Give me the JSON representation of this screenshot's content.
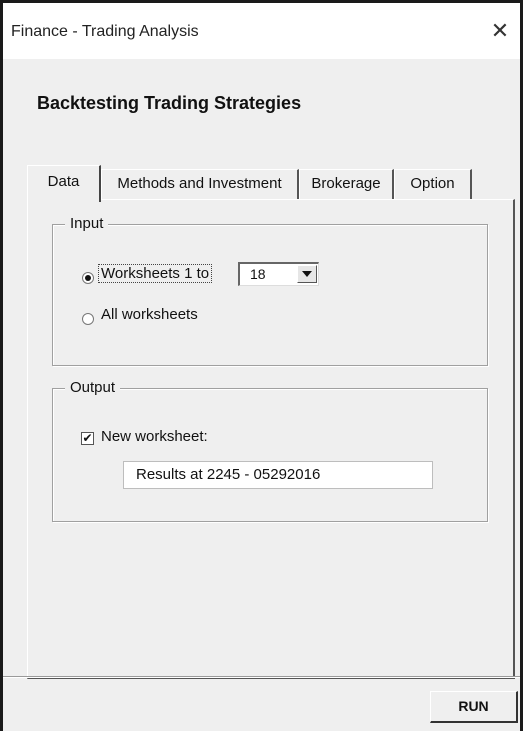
{
  "window": {
    "title": "Finance - Trading Analysis",
    "close_glyph": "✕"
  },
  "heading": "Backtesting Trading Strategies",
  "tabs": [
    {
      "label": "Data",
      "active": true
    },
    {
      "label": "Methods and Investment",
      "active": false
    },
    {
      "label": "Brokerage",
      "active": false
    },
    {
      "label": "Option",
      "active": false
    }
  ],
  "input_group": {
    "legend": "Input",
    "radio_worksheets_label": "Worksheets 1 to",
    "radio_worksheets_selected": true,
    "worksheet_count": "18",
    "radio_all_label": "All worksheets",
    "radio_all_selected": false
  },
  "output_group": {
    "legend": "Output",
    "new_worksheet_label": "New worksheet:",
    "new_worksheet_checked": true,
    "check_glyph": "✔",
    "result_name": "Results at 2245 - 05292016"
  },
  "run_button": "RUN",
  "icons": {
    "close": "close-icon",
    "dropdown": "chevron-down-icon"
  }
}
